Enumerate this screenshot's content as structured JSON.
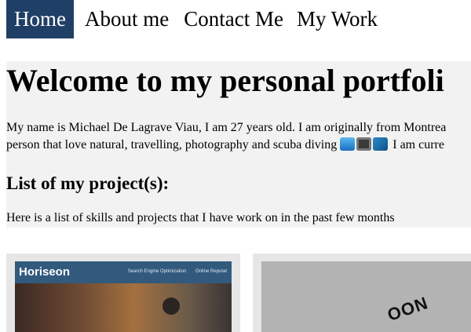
{
  "nav": {
    "items": [
      {
        "label": "Home",
        "active": true
      },
      {
        "label": "About me"
      },
      {
        "label": "Contact Me"
      },
      {
        "label": "My Work"
      }
    ],
    "active_color": "#1f3f66"
  },
  "intro": {
    "title": "Welcome to my personal portfoli",
    "text_line1": "My name is Michael De Lagrave Viau, I am 27 years old. I am originally from Montrea",
    "text_line2_before": "person that love natural, travelling, photography and scuba diving",
    "emojis": [
      "wave-emoji",
      "camera-emoji",
      "dolphin-emoji"
    ],
    "text_line2_after": "I am curre",
    "projects_heading": "List of my project(s):",
    "projects_description": "Here is a list of skills and projects that I have work on in the past few months",
    "panel_color": "#f2f2f2"
  },
  "projects": [
    {
      "screenshot": {
        "brand": "Horiseon",
        "nav_links": [
          "Search Engine Optimization",
          "Online Reputat"
        ]
      }
    },
    {
      "screenshot": {
        "text": "OON"
      }
    }
  ]
}
